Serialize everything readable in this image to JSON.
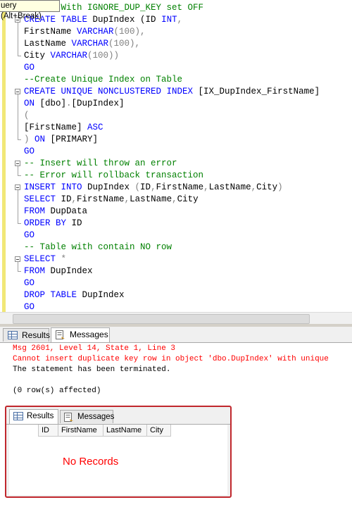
{
  "tooltip": "uery (Alt+Break)",
  "editor": {
    "lines": [
      [
        {
          "t": "on 1 - With IGNORE_DUP_KEY set OFF",
          "c": "cm"
        }
      ],
      [
        {
          "t": "CREATE TABLE ",
          "c": "kw"
        },
        {
          "t": "DupIndex (ID ",
          "c": "tx"
        },
        {
          "t": "INT",
          "c": "kw"
        },
        {
          "t": ",",
          "c": "gr"
        }
      ],
      [
        {
          "t": "FirstName ",
          "c": "tx"
        },
        {
          "t": "VARCHAR",
          "c": "kw"
        },
        {
          "t": "(100),",
          "c": "gr"
        }
      ],
      [
        {
          "t": "LastName ",
          "c": "tx"
        },
        {
          "t": "VARCHAR",
          "c": "kw"
        },
        {
          "t": "(100),",
          "c": "gr"
        }
      ],
      [
        {
          "t": "City ",
          "c": "tx"
        },
        {
          "t": "VARCHAR",
          "c": "kw"
        },
        {
          "t": "(100))",
          "c": "gr"
        }
      ],
      [
        {
          "t": "GO",
          "c": "kw"
        }
      ],
      [
        {
          "t": "--Create Unique Index on Table",
          "c": "cm"
        }
      ],
      [
        {
          "t": "CREATE UNIQUE NONCLUSTERED INDEX ",
          "c": "kw"
        },
        {
          "t": "[IX_DupIndex_FirstName]",
          "c": "tx"
        }
      ],
      [
        {
          "t": "ON ",
          "c": "kw"
        },
        {
          "t": "[dbo]",
          "c": "tx"
        },
        {
          "t": ".",
          "c": "gr"
        },
        {
          "t": "[DupIndex]",
          "c": "tx"
        }
      ],
      [
        {
          "t": "(",
          "c": "gr"
        }
      ],
      [
        {
          "t": "[FirstName] ",
          "c": "tx"
        },
        {
          "t": "ASC",
          "c": "kw"
        }
      ],
      [
        {
          "t": ") ",
          "c": "gr"
        },
        {
          "t": "ON ",
          "c": "kw"
        },
        {
          "t": "[PRIMARY]",
          "c": "tx"
        }
      ],
      [
        {
          "t": "GO",
          "c": "kw"
        }
      ],
      [
        {
          "t": "-- Insert will throw an error",
          "c": "cm"
        }
      ],
      [
        {
          "t": "-- Error will rollback transaction",
          "c": "cm"
        }
      ],
      [
        {
          "t": "INSERT INTO ",
          "c": "kw"
        },
        {
          "t": "DupIndex ",
          "c": "tx"
        },
        {
          "t": "(",
          "c": "gr"
        },
        {
          "t": "ID",
          "c": "tx"
        },
        {
          "t": ",",
          "c": "gr"
        },
        {
          "t": "FirstName",
          "c": "tx"
        },
        {
          "t": ",",
          "c": "gr"
        },
        {
          "t": "LastName",
          "c": "tx"
        },
        {
          "t": ",",
          "c": "gr"
        },
        {
          "t": "City",
          "c": "tx"
        },
        {
          "t": ")",
          "c": "gr"
        }
      ],
      [
        {
          "t": "SELECT ",
          "c": "kw"
        },
        {
          "t": "ID",
          "c": "tx"
        },
        {
          "t": ",",
          "c": "gr"
        },
        {
          "t": "FirstName",
          "c": "tx"
        },
        {
          "t": ",",
          "c": "gr"
        },
        {
          "t": "LastName",
          "c": "tx"
        },
        {
          "t": ",",
          "c": "gr"
        },
        {
          "t": "City",
          "c": "tx"
        }
      ],
      [
        {
          "t": "FROM ",
          "c": "kw"
        },
        {
          "t": "DupData",
          "c": "tx"
        }
      ],
      [
        {
          "t": "ORDER BY ",
          "c": "kw"
        },
        {
          "t": "ID",
          "c": "tx"
        }
      ],
      [
        {
          "t": "GO",
          "c": "kw"
        }
      ],
      [
        {
          "t": "-- Table with contain NO row",
          "c": "cm"
        }
      ],
      [
        {
          "t": "SELECT ",
          "c": "kw"
        },
        {
          "t": "*",
          "c": "gr"
        }
      ],
      [
        {
          "t": "FROM ",
          "c": "kw"
        },
        {
          "t": "DupIndex",
          "c": "tx"
        }
      ],
      [
        {
          "t": "GO",
          "c": "kw"
        }
      ],
      [
        {
          "t": "DROP TABLE ",
          "c": "kw"
        },
        {
          "t": "DupIndex",
          "c": "tx"
        }
      ],
      [
        {
          "t": "GO",
          "c": "kw"
        }
      ]
    ]
  },
  "tabs": [
    {
      "label": "Results",
      "icon": "grid-icon",
      "active": false
    },
    {
      "label": "Messages",
      "icon": "messages-icon",
      "active": true
    }
  ],
  "messages": [
    {
      "text": "Msg 2601, Level 14, State 1, Line 3",
      "kind": "err"
    },
    {
      "text": "Cannot insert duplicate key row in object 'dbo.DupIndex' with unique",
      "kind": "err"
    },
    {
      "text": "The statement has been terminated.",
      "kind": "ok"
    },
    {
      "text": "",
      "kind": "ok"
    },
    {
      "text": "(0 row(s) affected)",
      "kind": "ok"
    }
  ],
  "inset": {
    "tabs": [
      {
        "label": "Results",
        "icon": "grid-icon",
        "active": true
      },
      {
        "label": "Messages",
        "icon": "messages-icon",
        "active": false
      }
    ],
    "columns": [
      "ID",
      "FirstName",
      "LastName",
      "City"
    ],
    "annotation": "No Records"
  },
  "colors": {
    "keyword": "#0000ff",
    "comment": "#008000",
    "error": "#ff0000",
    "highlight": "#c0272d"
  }
}
